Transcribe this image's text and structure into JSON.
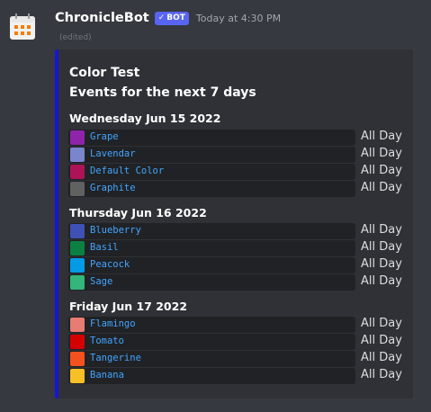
{
  "message": {
    "username": "ChronicleBot",
    "bot_badge": "BOT",
    "timestamp": "Today at 4:30 PM",
    "edited": "(edited)"
  },
  "embed": {
    "accent_color": "#1515d6",
    "title": "Color Test",
    "subtitle": "Events for the next 7 days",
    "days": [
      {
        "title": "Wednesday Jun 15 2022",
        "events": [
          {
            "name": "Grape",
            "color": "#8e24aa",
            "time": "All Day"
          },
          {
            "name": "Lavendar",
            "color": "#7986cb",
            "time": "All Day"
          },
          {
            "name": "Default Color",
            "color": "#ad1457",
            "time": "All Day"
          },
          {
            "name": "Graphite",
            "color": "#616161",
            "time": "All Day"
          }
        ]
      },
      {
        "title": "Thursday Jun 16 2022",
        "events": [
          {
            "name": "Blueberry",
            "color": "#3f51b5",
            "time": "All Day"
          },
          {
            "name": "Basil",
            "color": "#0b8043",
            "time": "All Day"
          },
          {
            "name": "Peacock",
            "color": "#039be5",
            "time": "All Day"
          },
          {
            "name": "Sage",
            "color": "#33b679",
            "time": "All Day"
          }
        ]
      },
      {
        "title": "Friday Jun 17 2022",
        "events": [
          {
            "name": "Flamingo",
            "color": "#e67c73",
            "time": "All Day"
          },
          {
            "name": "Tomato",
            "color": "#d50000",
            "time": "All Day"
          },
          {
            "name": "Tangerine",
            "color": "#f4511e",
            "time": "All Day"
          },
          {
            "name": "Banana",
            "color": "#f6bf26",
            "time": "All Day"
          }
        ]
      }
    ]
  }
}
